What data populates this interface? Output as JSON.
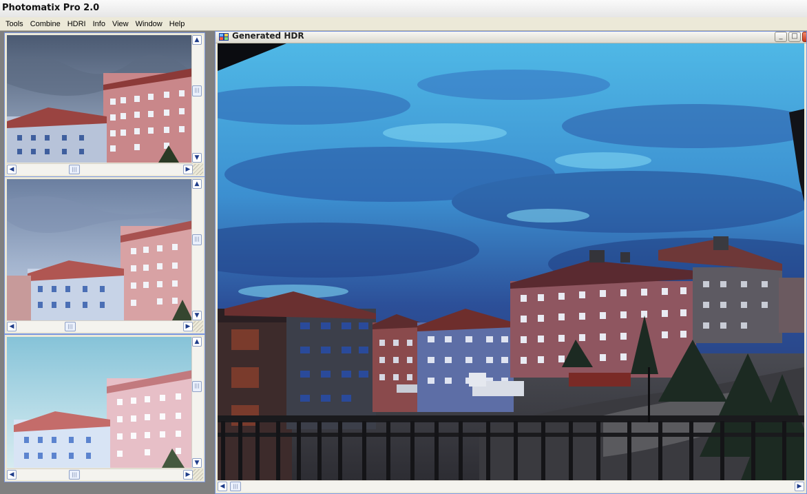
{
  "app": {
    "title": "Photomatix Pro 2.0"
  },
  "menu": {
    "items": [
      "Tools",
      "Combine",
      "HDRI",
      "Info",
      "View",
      "Window",
      "Help"
    ]
  },
  "hdr_window": {
    "title": "Generated HDR"
  },
  "icons": {
    "scroll_up": "▲",
    "scroll_down": "▼",
    "scroll_left": "◀",
    "scroll_right": "▶",
    "minimize": "_",
    "maximize": "□",
    "close": "✕",
    "grip": "|||"
  },
  "colors": {
    "xp_blue_border": "#7a96df",
    "window_face": "#ece9d8",
    "close_red": "#c9371b"
  }
}
